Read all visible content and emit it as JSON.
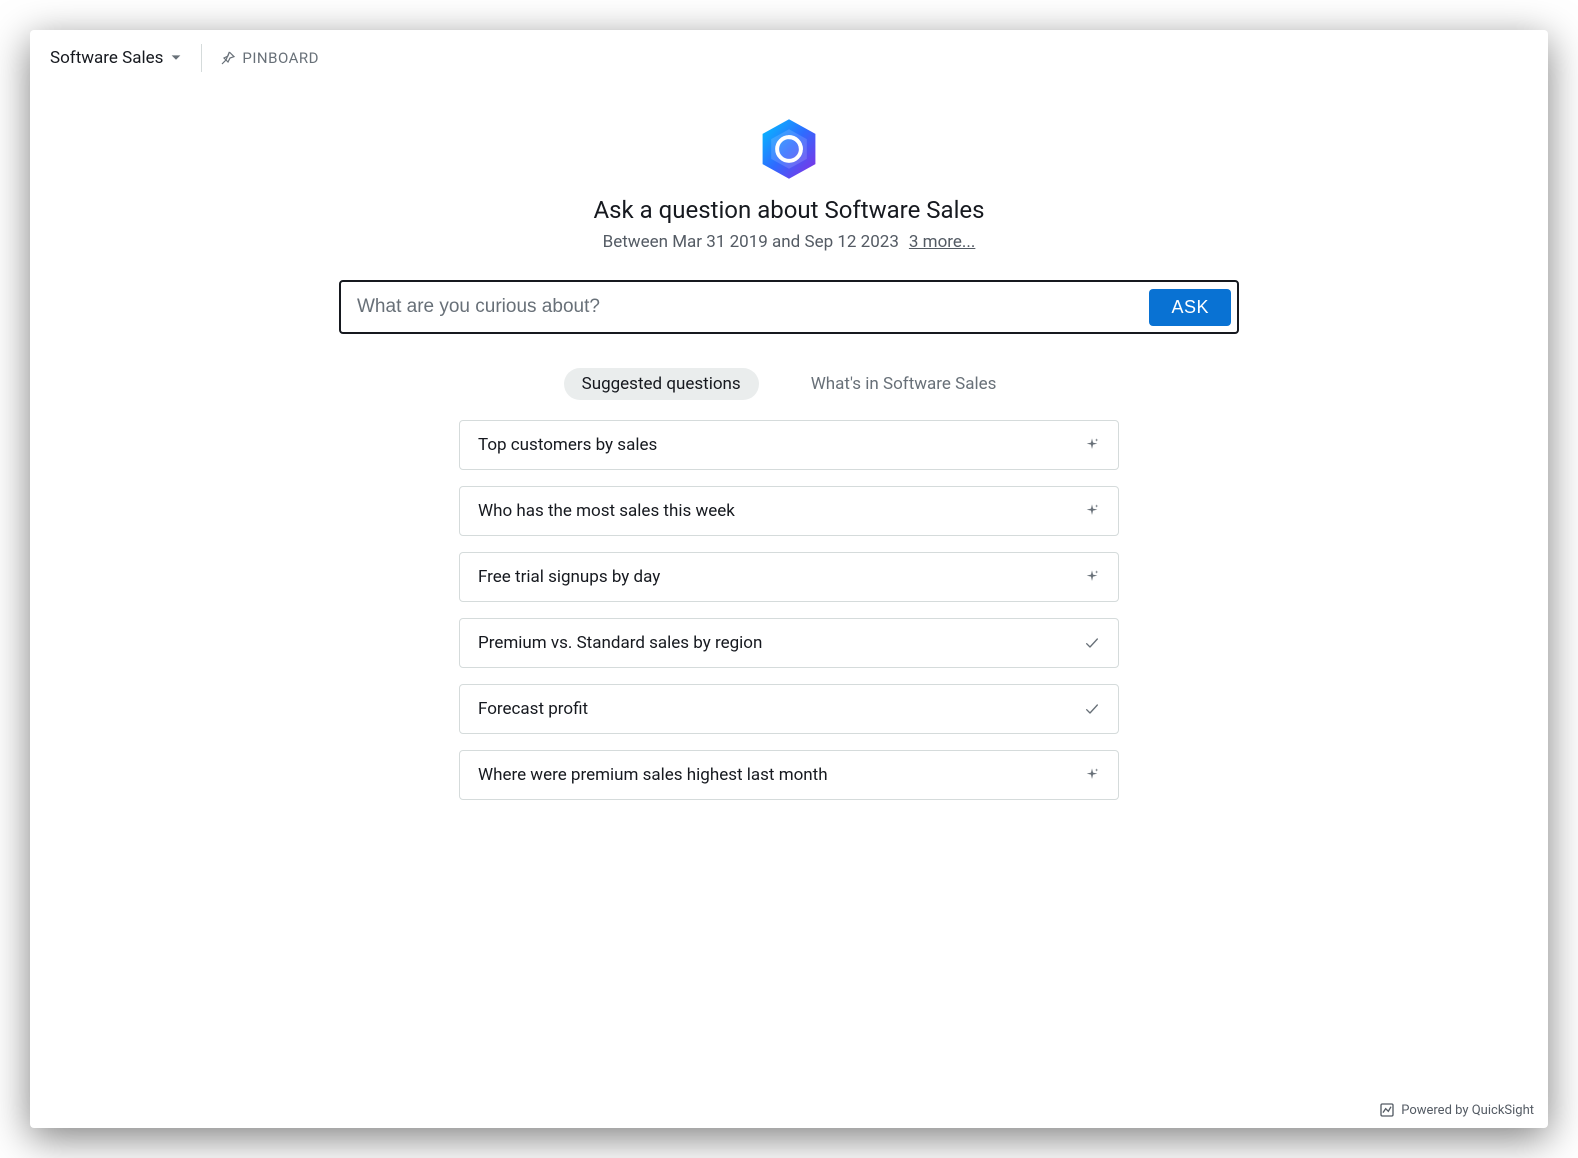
{
  "header": {
    "topic_label": "Software Sales",
    "pinboard_label": "PINBOARD"
  },
  "hero": {
    "title": "Ask a question about Software Sales",
    "date_range": "Between Mar 31 2019 and Sep 12 2023",
    "more_link": "3 more..."
  },
  "search": {
    "placeholder": "What are you curious about?",
    "ask_label": "ASK"
  },
  "tabs": {
    "suggested": "Suggested questions",
    "whatsin": "What's in Software Sales"
  },
  "questions": [
    {
      "text": "Top customers by sales",
      "icon": "sparkle"
    },
    {
      "text": "Who has the most sales this week",
      "icon": "sparkle"
    },
    {
      "text": "Free trial signups by day",
      "icon": "sparkle"
    },
    {
      "text": "Premium vs. Standard sales by region",
      "icon": "check"
    },
    {
      "text": "Forecast profit",
      "icon": "check"
    },
    {
      "text": "Where were premium sales highest last month",
      "icon": "sparkle"
    }
  ],
  "footer": {
    "powered_by": "Powered by QuickSight"
  }
}
